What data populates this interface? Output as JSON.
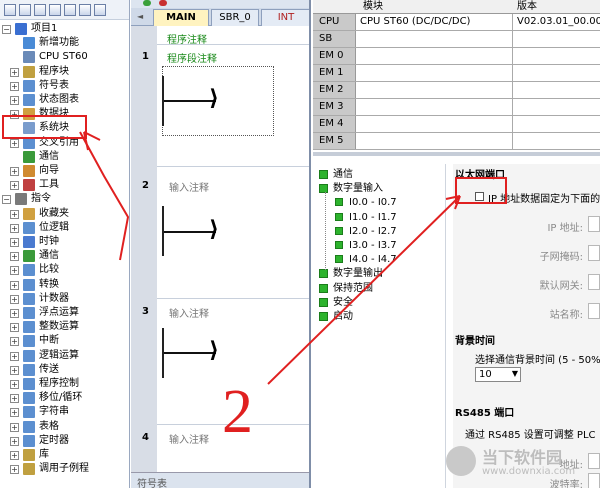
{
  "tree": {
    "items": [
      {
        "label": "项目1",
        "level": 0,
        "exp": "−",
        "icon": "project-icon",
        "color": "#3a6fd1"
      },
      {
        "label": "新增功能",
        "level": 1,
        "exp": "",
        "icon": "help-icon",
        "color": "#4a8bd6"
      },
      {
        "label": "CPU ST60",
        "level": 1,
        "exp": "",
        "icon": "cpu-icon",
        "color": "#6a8ab8"
      },
      {
        "label": "程序块",
        "level": 1,
        "exp": "+",
        "icon": "program-block-icon",
        "color": "#c0a040"
      },
      {
        "label": "符号表",
        "level": 1,
        "exp": "+",
        "icon": "symbol-table-icon",
        "color": "#5c8fd0"
      },
      {
        "label": "状态图表",
        "level": 1,
        "exp": "+",
        "icon": "status-chart-icon",
        "color": "#5c8fd0"
      },
      {
        "label": "数据块",
        "level": 1,
        "exp": "+",
        "icon": "data-block-icon",
        "color": "#d0a040"
      },
      {
        "label": "系统块",
        "level": 1,
        "exp": "",
        "icon": "system-block-icon",
        "color": "#7a9ccc"
      },
      {
        "label": "交叉引用",
        "level": 1,
        "exp": "+",
        "icon": "cross-ref-icon",
        "color": "#5c8fd0"
      },
      {
        "label": "通信",
        "level": 1,
        "exp": "",
        "icon": "comm-icon",
        "color": "#3a9a3a"
      },
      {
        "label": "向导",
        "level": 1,
        "exp": "+",
        "icon": "wizard-icon",
        "color": "#d08a30"
      },
      {
        "label": "工具",
        "level": 1,
        "exp": "+",
        "icon": "tools-icon",
        "color": "#c04040"
      },
      {
        "label": "指令",
        "level": 0,
        "exp": "−",
        "icon": "instructions-icon",
        "color": "#7a7a7a"
      },
      {
        "label": "收藏夹",
        "level": 1,
        "exp": "+",
        "icon": "favorites-icon",
        "color": "#d0a040"
      },
      {
        "label": "位逻辑",
        "level": 1,
        "exp": "+",
        "icon": "bit-logic-icon",
        "color": "#5c8fd0"
      },
      {
        "label": "时钟",
        "level": 1,
        "exp": "+",
        "icon": "clock-icon",
        "color": "#4a7ad0"
      },
      {
        "label": "通信",
        "level": 1,
        "exp": "+",
        "icon": "comm-icon",
        "color": "#3a9a3a"
      },
      {
        "label": "比较",
        "level": 1,
        "exp": "+",
        "icon": "compare-icon",
        "color": "#5c8fd0"
      },
      {
        "label": "转换",
        "level": 1,
        "exp": "+",
        "icon": "convert-icon",
        "color": "#5c8fd0"
      },
      {
        "label": "计数器",
        "level": 1,
        "exp": "+",
        "icon": "counter-icon",
        "color": "#5c8fd0"
      },
      {
        "label": "浮点运算",
        "level": 1,
        "exp": "+",
        "icon": "float-math-icon",
        "color": "#5c8fd0"
      },
      {
        "label": "整数运算",
        "level": 1,
        "exp": "+",
        "icon": "int-math-icon",
        "color": "#5c8fd0"
      },
      {
        "label": "中断",
        "level": 1,
        "exp": "+",
        "icon": "interrupt-icon",
        "color": "#5c8fd0"
      },
      {
        "label": "逻辑运算",
        "level": 1,
        "exp": "+",
        "icon": "logic-op-icon",
        "color": "#5c8fd0"
      },
      {
        "label": "传送",
        "level": 1,
        "exp": "+",
        "icon": "move-icon",
        "color": "#5c8fd0"
      },
      {
        "label": "程序控制",
        "level": 1,
        "exp": "+",
        "icon": "program-control-icon",
        "color": "#5c8fd0"
      },
      {
        "label": "移位/循环",
        "level": 1,
        "exp": "+",
        "icon": "shift-rotate-icon",
        "color": "#5c8fd0"
      },
      {
        "label": "字符串",
        "level": 1,
        "exp": "+",
        "icon": "string-icon",
        "color": "#5c8fd0"
      },
      {
        "label": "表格",
        "level": 1,
        "exp": "+",
        "icon": "table-icon",
        "color": "#5c8fd0"
      },
      {
        "label": "定时器",
        "level": 1,
        "exp": "+",
        "icon": "timer-icon",
        "color": "#5c8fd0"
      },
      {
        "label": "库",
        "level": 1,
        "exp": "+",
        "icon": "library-icon",
        "color": "#c0a040"
      },
      {
        "label": "调用子例程",
        "level": 1,
        "exp": "+",
        "icon": "subroutine-icon",
        "color": "#c0a040"
      }
    ]
  },
  "editor": {
    "tabs": [
      "MAIN",
      "SBR_0",
      "INT"
    ],
    "header_comment": "程序注释",
    "rungs": [
      {
        "num": "1",
        "comment": "程序段注释"
      },
      {
        "num": "2",
        "comment": "输入注释"
      },
      {
        "num": "3",
        "comment": "输入注释"
      },
      {
        "num": "4",
        "comment": "输入注释"
      }
    ],
    "bottom_label": "符号表"
  },
  "modules": {
    "headers": [
      "",
      "模块",
      "版本"
    ],
    "rows": [
      {
        "slot": "CPU",
        "module": "CPU ST60 (DC/DC/DC)",
        "version": "V02.03.01_00.00.0..."
      },
      {
        "slot": "SB",
        "module": "",
        "version": ""
      },
      {
        "slot": "EM 0",
        "module": "",
        "version": ""
      },
      {
        "slot": "EM 1",
        "module": "",
        "version": ""
      },
      {
        "slot": "EM 2",
        "module": "",
        "version": ""
      },
      {
        "slot": "EM 3",
        "module": "",
        "version": ""
      },
      {
        "slot": "EM 4",
        "module": "",
        "version": ""
      },
      {
        "slot": "EM 5",
        "module": "",
        "version": ""
      }
    ]
  },
  "categories": [
    {
      "label": "通信",
      "indent": 0
    },
    {
      "label": "数字量输入",
      "indent": 0
    },
    {
      "label": "I0.0 - I0.7",
      "indent": 1
    },
    {
      "label": "I1.0 - I1.7",
      "indent": 1
    },
    {
      "label": "I2.0 - I2.7",
      "indent": 1
    },
    {
      "label": "I3.0 - I3.7",
      "indent": 1
    },
    {
      "label": "I4.0 - I4.7",
      "indent": 1
    },
    {
      "label": "数字量输出",
      "indent": 0
    },
    {
      "label": "保持范围",
      "indent": 0
    },
    {
      "label": "安全",
      "indent": 0
    },
    {
      "label": "启动",
      "indent": 0
    }
  ],
  "props": {
    "ethernet_title": "以太网端口",
    "ip_fixed_checkbox": "IP 地址数据固定为下面的",
    "ip_label": "IP 地址:",
    "mask_label": "子网掩码:",
    "gateway_label": "默认网关:",
    "station_label": "站名称:",
    "bg_title": "背景时间",
    "bg_desc": "选择通信背景时间 (5 - 50%",
    "bg_value": "10",
    "rs485_title": "RS485 端口",
    "rs485_desc": "通过 RS485 设置可调整 PLC",
    "addr_label": "地址:",
    "baud_label": "波特率:"
  },
  "watermark": {
    "name": "当下软件园",
    "url": "www.downxia.com"
  },
  "annotations": {
    "marker": "2",
    "color": "#e02020"
  }
}
